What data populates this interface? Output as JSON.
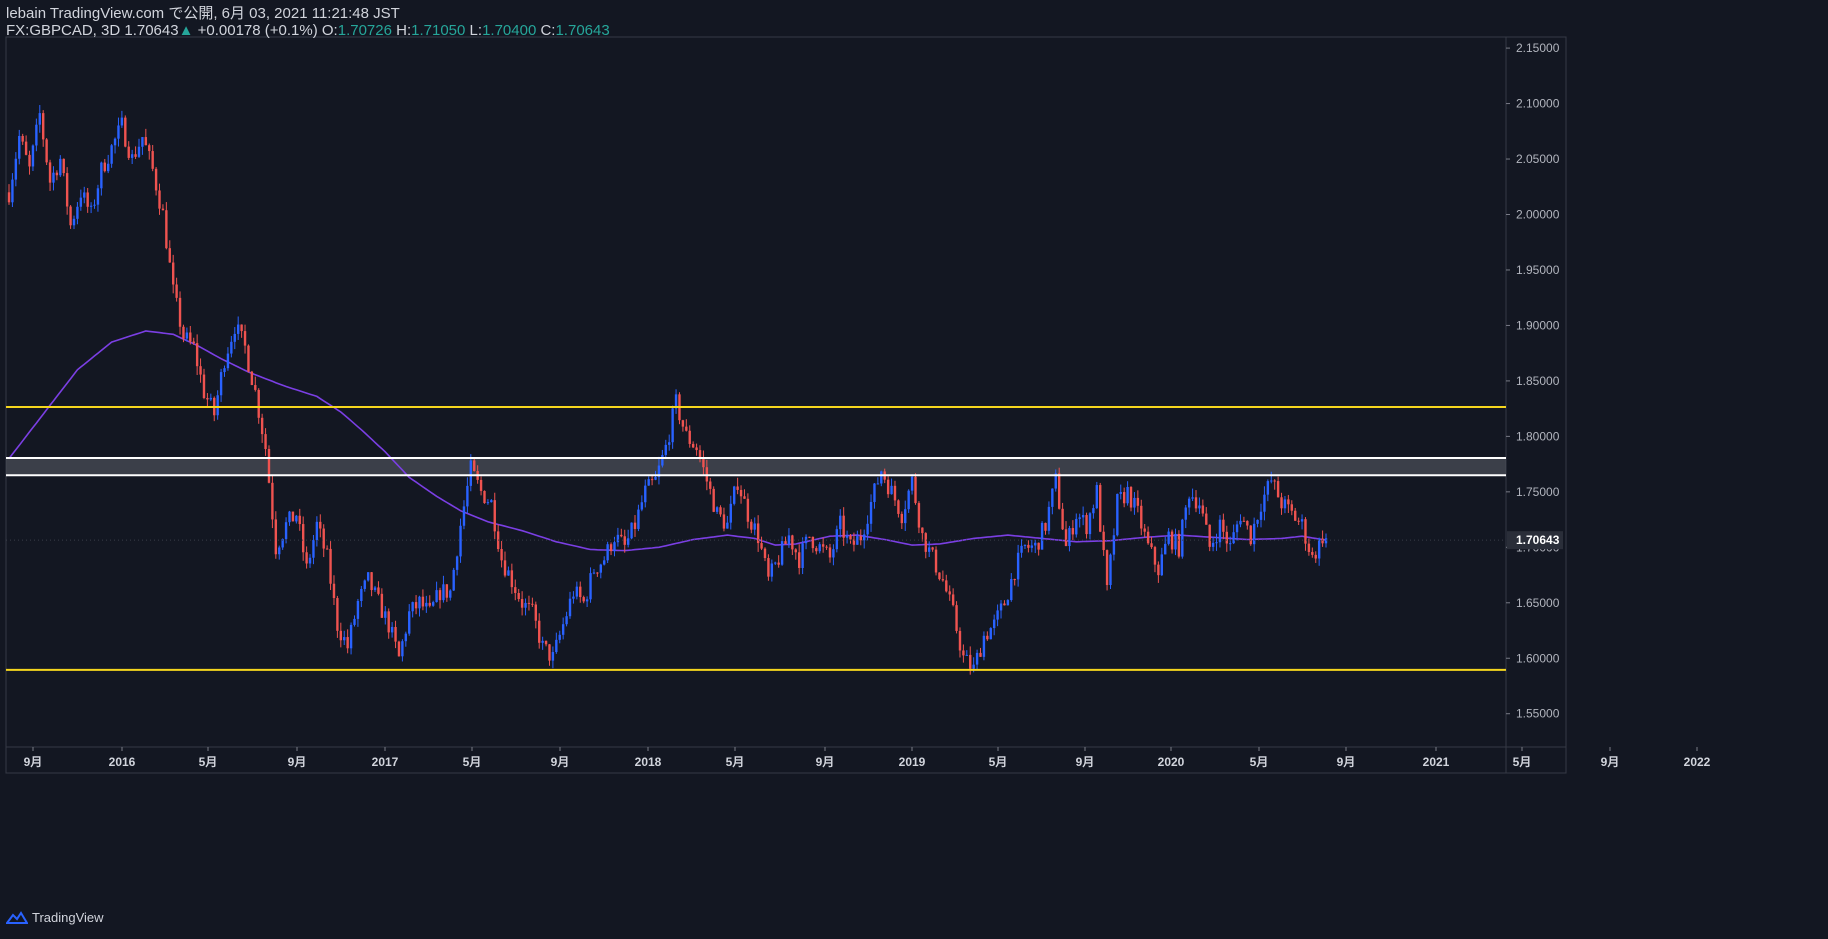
{
  "header": {
    "publisher": "lebain TradingView.com で公開, 6月 03, 2021 11:21:48 JST",
    "symbol": "FX:GBPCAD, 3D 1.70643",
    "change_arrow": "▲",
    "change": "+0.00178 (+0.1%)",
    "open_label": "O:",
    "open": "1.70726",
    "high_label": "H:",
    "high": "1.71050",
    "low_label": "L:",
    "low": "1.70400",
    "close_label": "C:",
    "close": "1.70643"
  },
  "footer": {
    "brand": "TradingView"
  },
  "colors": {
    "background": "#131722",
    "up": "#2962ff",
    "down": "#ef5350",
    "ma": "#7b3fe4",
    "support_resistance": "#f5d61e",
    "zone_border": "#ffffff",
    "zone_fill": "#4a4d57"
  },
  "chart_data": {
    "type": "candlestick",
    "symbol": "FX:GBPCAD",
    "interval": "3D",
    "ylim": [
      1.52,
      2.16
    ],
    "price_ticks": [
      "2.15000",
      "2.10000",
      "2.05000",
      "2.00000",
      "1.95000",
      "1.90000",
      "1.85000",
      "1.80000",
      "1.75000",
      "1.70000",
      "1.65000",
      "1.60000",
      "1.55000"
    ],
    "last_price_label": "1.70643",
    "last_price": 1.70643,
    "time_ticks": [
      "9月",
      "2016",
      "5月",
      "9月",
      "2017",
      "5月",
      "9月",
      "2018",
      "5月",
      "9月",
      "2019",
      "5月",
      "9月",
      "2020",
      "5月",
      "9月",
      "2021",
      "5月",
      "9月",
      "2022"
    ],
    "horizontal_lines": [
      {
        "price": 1.8265,
        "color": "#f5d61e"
      },
      {
        "price": 1.5895,
        "color": "#f5d61e"
      }
    ],
    "zone": {
      "top": 1.7805,
      "bottom": 1.765
    },
    "price_path": [
      [
        0,
        2.02
      ],
      [
        3,
        2.07
      ],
      [
        6,
        2.04
      ],
      [
        9,
        2.09
      ],
      [
        12,
        2.03
      ],
      [
        15,
        2.05
      ],
      [
        18,
        1.99
      ],
      [
        21,
        2.02
      ],
      [
        24,
        2.0
      ],
      [
        27,
        2.04
      ],
      [
        30,
        2.06
      ],
      [
        33,
        2.08
      ],
      [
        36,
        2.05
      ],
      [
        39,
        2.07
      ],
      [
        42,
        2.04
      ],
      [
        45,
        2.0
      ],
      [
        48,
        1.93
      ],
      [
        51,
        1.89
      ],
      [
        54,
        1.88
      ],
      [
        57,
        1.84
      ],
      [
        60,
        1.82
      ],
      [
        63,
        1.87
      ],
      [
        66,
        1.9
      ],
      [
        69,
        1.88
      ],
      [
        72,
        1.84
      ],
      [
        75,
        1.79
      ],
      [
        78,
        1.7
      ],
      [
        81,
        1.72
      ],
      [
        84,
        1.73
      ],
      [
        87,
        1.68
      ],
      [
        90,
        1.72
      ],
      [
        93,
        1.69
      ],
      [
        96,
        1.63
      ],
      [
        99,
        1.61
      ],
      [
        102,
        1.65
      ],
      [
        105,
        1.67
      ],
      [
        108,
        1.65
      ],
      [
        111,
        1.63
      ],
      [
        114,
        1.6
      ],
      [
        117,
        1.64
      ],
      [
        120,
        1.65
      ],
      [
        123,
        1.64
      ],
      [
        126,
        1.66
      ],
      [
        129,
        1.66
      ],
      [
        132,
        1.72
      ],
      [
        135,
        1.77
      ],
      [
        138,
        1.75
      ],
      [
        141,
        1.74
      ],
      [
        144,
        1.69
      ],
      [
        147,
        1.67
      ],
      [
        150,
        1.65
      ],
      [
        153,
        1.64
      ],
      [
        156,
        1.61
      ],
      [
        159,
        1.6
      ],
      [
        162,
        1.63
      ],
      [
        165,
        1.66
      ],
      [
        168,
        1.65
      ],
      [
        171,
        1.68
      ],
      [
        174,
        1.69
      ],
      [
        177,
        1.71
      ],
      [
        180,
        1.7
      ],
      [
        183,
        1.72
      ],
      [
        186,
        1.75
      ],
      [
        189,
        1.76
      ],
      [
        192,
        1.79
      ],
      [
        195,
        1.83
      ],
      [
        198,
        1.8
      ],
      [
        201,
        1.79
      ],
      [
        204,
        1.76
      ],
      [
        207,
        1.73
      ],
      [
        210,
        1.72
      ],
      [
        213,
        1.76
      ],
      [
        216,
        1.73
      ],
      [
        219,
        1.71
      ],
      [
        222,
        1.67
      ],
      [
        225,
        1.69
      ],
      [
        228,
        1.71
      ],
      [
        231,
        1.69
      ],
      [
        234,
        1.71
      ],
      [
        237,
        1.7
      ],
      [
        240,
        1.69
      ],
      [
        243,
        1.72
      ],
      [
        246,
        1.7
      ],
      [
        249,
        1.71
      ],
      [
        252,
        1.74
      ],
      [
        255,
        1.77
      ],
      [
        258,
        1.75
      ],
      [
        261,
        1.73
      ],
      [
        264,
        1.76
      ],
      [
        267,
        1.71
      ],
      [
        270,
        1.69
      ],
      [
        273,
        1.67
      ],
      [
        276,
        1.64
      ],
      [
        279,
        1.6
      ],
      [
        282,
        1.59
      ],
      [
        285,
        1.62
      ],
      [
        288,
        1.63
      ],
      [
        291,
        1.65
      ],
      [
        294,
        1.68
      ],
      [
        297,
        1.7
      ],
      [
        300,
        1.7
      ],
      [
        303,
        1.72
      ],
      [
        306,
        1.76
      ],
      [
        309,
        1.7
      ],
      [
        312,
        1.73
      ],
      [
        315,
        1.72
      ],
      [
        318,
        1.75
      ],
      [
        321,
        1.66
      ],
      [
        324,
        1.74
      ],
      [
        327,
        1.75
      ],
      [
        330,
        1.73
      ],
      [
        333,
        1.7
      ],
      [
        336,
        1.68
      ],
      [
        339,
        1.71
      ],
      [
        342,
        1.7
      ],
      [
        345,
        1.75
      ],
      [
        348,
        1.74
      ],
      [
        351,
        1.7
      ],
      [
        354,
        1.72
      ],
      [
        357,
        1.7
      ],
      [
        360,
        1.73
      ],
      [
        363,
        1.71
      ],
      [
        366,
        1.74
      ],
      [
        369,
        1.76
      ],
      [
        372,
        1.74
      ],
      [
        375,
        1.73
      ],
      [
        378,
        1.72
      ],
      [
        381,
        1.69
      ],
      [
        384,
        1.71
      ],
      [
        385,
        1.70643
      ]
    ],
    "ma_path": [
      [
        0,
        1.78
      ],
      [
        10,
        1.82
      ],
      [
        20,
        1.86
      ],
      [
        30,
        1.885
      ],
      [
        40,
        1.895
      ],
      [
        48,
        1.892
      ],
      [
        55,
        1.882
      ],
      [
        62,
        1.87
      ],
      [
        70,
        1.858
      ],
      [
        80,
        1.846
      ],
      [
        90,
        1.836
      ],
      [
        97,
        1.822
      ],
      [
        103,
        1.806
      ],
      [
        110,
        1.786
      ],
      [
        117,
        1.763
      ],
      [
        125,
        1.746
      ],
      [
        132,
        1.733
      ],
      [
        140,
        1.723
      ],
      [
        150,
        1.715
      ],
      [
        160,
        1.705
      ],
      [
        170,
        1.698
      ],
      [
        180,
        1.697
      ],
      [
        190,
        1.7
      ],
      [
        200,
        1.707
      ],
      [
        210,
        1.711
      ],
      [
        218,
        1.708
      ],
      [
        224,
        1.702
      ],
      [
        230,
        1.703
      ],
      [
        240,
        1.71
      ],
      [
        248,
        1.711
      ],
      [
        256,
        1.707
      ],
      [
        264,
        1.702
      ],
      [
        272,
        1.703
      ],
      [
        282,
        1.708
      ],
      [
        292,
        1.711
      ],
      [
        302,
        1.708
      ],
      [
        312,
        1.705
      ],
      [
        322,
        1.706
      ],
      [
        332,
        1.709
      ],
      [
        342,
        1.711
      ],
      [
        352,
        1.709
      ],
      [
        362,
        1.707
      ],
      [
        372,
        1.708
      ],
      [
        378,
        1.71
      ],
      [
        385,
        1.7065
      ]
    ]
  }
}
